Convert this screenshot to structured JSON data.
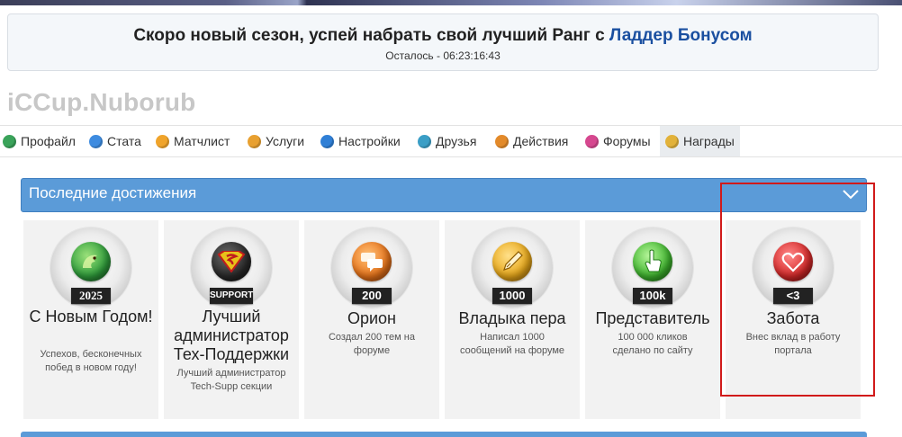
{
  "notice": {
    "text": "Скоро новый сезон, успей набрать свой лучший Ранг с ",
    "link": "Ладдер Бонусом",
    "timer": "Осталось - 06:23:16:43"
  },
  "profile": {
    "username": "iCCup.Nuborub"
  },
  "nav": {
    "items": [
      {
        "label": "Профайл",
        "icon": "profile-icon",
        "color": "#3aa35a"
      },
      {
        "label": "Стата",
        "icon": "stats-icon",
        "color": "#3d8be0"
      },
      {
        "label": "Матчлист",
        "icon": "matchlist-icon",
        "color": "#f0a42b"
      },
      {
        "label": "Услуги",
        "icon": "services-icon",
        "color": "#e8a030"
      },
      {
        "label": "Настройки",
        "icon": "settings-icon",
        "color": "#2f7fd6"
      },
      {
        "label": "Друзья",
        "icon": "friends-icon",
        "color": "#3a9ec6"
      },
      {
        "label": "Действия",
        "icon": "actions-icon",
        "color": "#e38a2a"
      },
      {
        "label": "Форумы",
        "icon": "forums-icon",
        "color": "#d6478f"
      },
      {
        "label": "Награды",
        "icon": "awards-icon",
        "color": "#e2b23a"
      }
    ]
  },
  "achievements": {
    "section_title": "Последние достижения",
    "items": [
      {
        "title": "С Новым Годом!",
        "badge": "2025",
        "desc": "Успехов, бесконечных побед в новом году!",
        "icon": "dragon-icon",
        "color": "#2f9e3c"
      },
      {
        "title": "Лучший администратор Тех-Поддержки",
        "badge": "SUPPORT",
        "desc": "Лучший администратор Tech-Supp секции",
        "icon": "superman-icon",
        "color": "#2a2a2a"
      },
      {
        "title": "Орион",
        "badge": "200",
        "desc": "Создал 200 тем на форуме",
        "icon": "chat-icon",
        "color": "#e8741a"
      },
      {
        "title": "Владыка пера",
        "badge": "1000",
        "desc": "Написал 1000 сообщений на форуме",
        "icon": "pen-icon",
        "color": "#e8a81a"
      },
      {
        "title": "Представитель",
        "badge": "100k",
        "desc": "100 000 кликов сделано по сайту",
        "icon": "pointer-icon",
        "color": "#3fb52e"
      },
      {
        "title": "Забота",
        "badge": "<3",
        "desc": "Внес вклад в работу портала",
        "icon": "heart-icon",
        "color": "#d62a2a"
      }
    ]
  }
}
